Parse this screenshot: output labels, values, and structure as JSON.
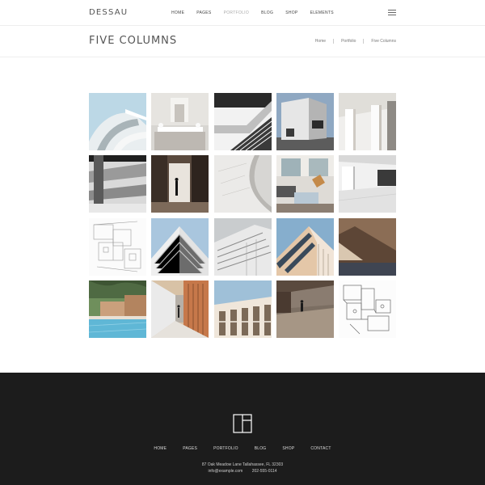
{
  "header": {
    "logo": "DESSAU",
    "nav": [
      {
        "label": "HOME",
        "active": false
      },
      {
        "label": "PAGES",
        "active": false
      },
      {
        "label": "PORTFOLIO",
        "active": true
      },
      {
        "label": "BLOG",
        "active": false
      },
      {
        "label": "SHOP",
        "active": false
      },
      {
        "label": "ELEMENTS",
        "active": false
      }
    ],
    "menu_icon": "hamburger-menu-icon"
  },
  "title_bar": {
    "title": "FIVE COLUMNS",
    "breadcrumb": [
      "Home",
      "Portfolio",
      "Five Columns"
    ]
  },
  "portfolio": {
    "columns": 5,
    "rows": 4,
    "items": [
      {
        "image": "white-curved-building-sky"
      },
      {
        "image": "white-interior-table"
      },
      {
        "image": "black-white-staircase"
      },
      {
        "image": "white-cube-building"
      },
      {
        "image": "white-interior-columns"
      },
      {
        "image": "grey-concrete-balconies"
      },
      {
        "image": "doorway-silhouette"
      },
      {
        "image": "concrete-curve-abstract"
      },
      {
        "image": "modern-living-room"
      },
      {
        "image": "white-interior-hall"
      },
      {
        "image": "floor-plan-sketch"
      },
      {
        "image": "stepped-white-tower"
      },
      {
        "image": "white-facade-louvers"
      },
      {
        "image": "angled-glass-building"
      },
      {
        "image": "brown-wall-shadow"
      },
      {
        "image": "pool-building-trees"
      },
      {
        "image": "corridor-person"
      },
      {
        "image": "building-facade-windows"
      },
      {
        "image": "plaza-person-walking"
      },
      {
        "image": "floor-plan-drawing"
      }
    ]
  },
  "footer": {
    "logo_icon": "square-logo-icon",
    "nav": [
      "HOME",
      "PAGES",
      "PORTFOLIO",
      "BLOG",
      "SHOP",
      "CONTACT"
    ],
    "address": "87 Oak Meadow Lane Tallahassee, FL 32303",
    "email": "info@example.com",
    "phone": "202-555-0114"
  }
}
